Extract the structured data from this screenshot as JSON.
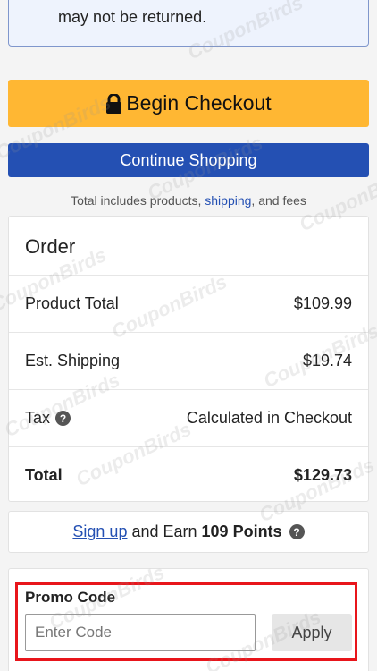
{
  "notice": {
    "line_cut": "~~~~~~~~~~~~~~~~",
    "line": "may not be returned."
  },
  "checkout": {
    "begin_label": "Begin Checkout",
    "continue_label": "Continue Shopping"
  },
  "totals_note": {
    "before": "Total includes products, ",
    "link": "shipping",
    "after": ", and fees"
  },
  "order": {
    "title": "Order",
    "rows": [
      {
        "label": "Product Total",
        "value": "$109.99"
      },
      {
        "label": "Est. Shipping",
        "value": "$19.74"
      },
      {
        "label": "Tax",
        "value": "Calculated in Checkout"
      },
      {
        "label": "Total",
        "value": "$129.73"
      }
    ]
  },
  "points": {
    "signup": "Sign up",
    "text": "and Earn",
    "points": "109 Points"
  },
  "promo": {
    "label": "Promo Code",
    "placeholder": "Enter Code",
    "apply": "Apply"
  },
  "watermark": "CouponBirds",
  "colors": {
    "checkout_bg": "#ffb733",
    "continue_bg": "#2450b3",
    "highlight": "#e8151b"
  }
}
